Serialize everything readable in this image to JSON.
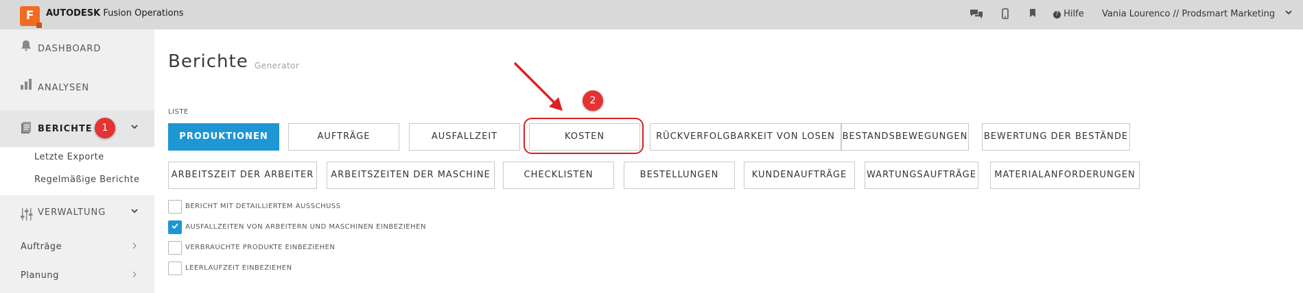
{
  "app": {
    "logo_letter": "F",
    "brand_bold": "AUTODESK",
    "brand_rest": "Fusion Operations"
  },
  "topbar": {
    "icons": [
      "chat-icon",
      "mobile-icon",
      "bookmark-icon"
    ],
    "help_icon": "question-circle-icon",
    "help_label": "Hilfe",
    "user_label": "Vania Lourenco // Prodsmart Marketing"
  },
  "sidebar": {
    "dashboard": "DASHBOARD",
    "analysen": "ANALYSEN",
    "berichte": "BERICHTE",
    "berichte_sub": [
      "Letzte Exporte",
      "Regelmäßige Berichte"
    ],
    "verwaltung": "VERWALTUNG",
    "auftraege": "Aufträge",
    "planung": "Planung"
  },
  "annotations": {
    "badge1": "1",
    "badge2": "2",
    "accent_color": "#e53232"
  },
  "main": {
    "title": "Berichte",
    "subtitle": "Generator",
    "list_label": "LISTE",
    "row1": [
      "PRODUKTIONEN",
      "AUFTRÄGE",
      "AUSFALLZEIT",
      "KOSTEN",
      "RÜCKVERFOLGBARKEIT VON LOSEN",
      "BESTANDSBEWEGUNGEN",
      "BEWERTUNG DER BESTÄNDE"
    ],
    "row2": [
      "ARBEITSZEIT DER ARBEITER",
      "ARBEITSZEITEN DER MASCHINE",
      "CHECKLISTEN",
      "BESTELLUNGEN",
      "KUNDENAUFTRÄGE",
      "WARTUNGSAUFTRÄGE",
      "MATERIALANFORDERUNGEN"
    ],
    "active_report": "PRODUKTIONEN",
    "options": [
      {
        "label": "BERICHT MIT DETAILLIERTEM AUSSCHUSS",
        "checked": false
      },
      {
        "label": "AUSFALLZEITEN VON ARBEITERN UND MASCHINEN EINBEZIEHEN",
        "checked": true
      },
      {
        "label": "VERBRAUCHTE PRODUKTE EINBEZIEHEN",
        "checked": false
      },
      {
        "label": "LEERLAUFZEIT EINBEZIEHEN",
        "checked": false
      }
    ],
    "primary_color": "#1f96d4"
  }
}
